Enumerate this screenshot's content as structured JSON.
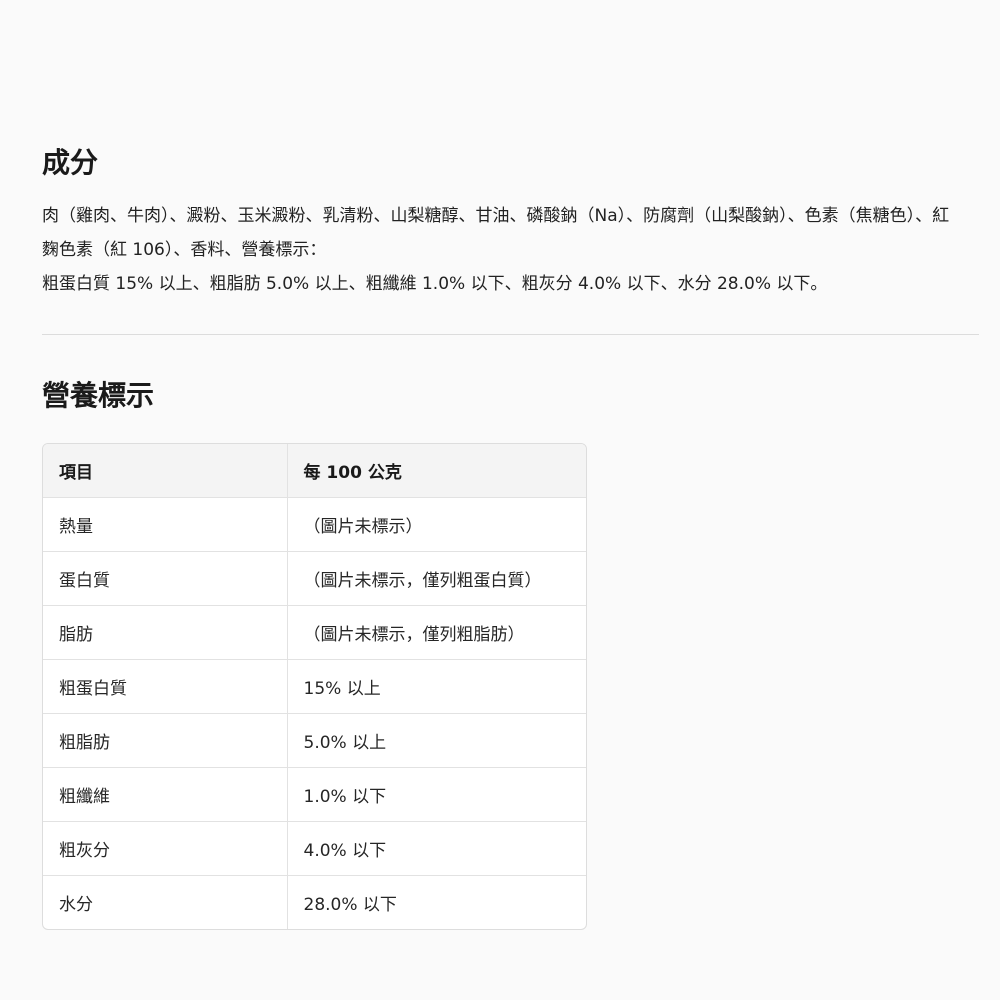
{
  "ingredients": {
    "title": "成分",
    "lines": [
      "肉（雞肉、牛肉）、澱粉、玉米澱粉、乳清粉、山梨糖醇、甘油、磷酸鈉（Na）、防腐劑（山梨酸鈉）、色素（焦糖色）、紅麴色素（紅 106）、香料、營養標示：",
      "粗蛋白質 15% 以上、粗脂肪 5.0% 以上、粗纖維 1.0% 以下、粗灰分 4.0% 以下、水分 28.0% 以下。"
    ]
  },
  "nutrition": {
    "title": "營養標示",
    "headers": [
      "項目",
      "每 100 公克"
    ],
    "rows": [
      [
        "熱量",
        "（圖片未標示）"
      ],
      [
        "蛋白質",
        "（圖片未標示，僅列粗蛋白質）"
      ],
      [
        "脂肪",
        "（圖片未標示，僅列粗脂肪）"
      ],
      [
        "粗蛋白質",
        "15% 以上"
      ],
      [
        "粗脂肪",
        "5.0% 以上"
      ],
      [
        "粗纖維",
        "1.0% 以下"
      ],
      [
        "粗灰分",
        "4.0% 以下"
      ],
      [
        "水分",
        "28.0% 以下"
      ]
    ]
  }
}
